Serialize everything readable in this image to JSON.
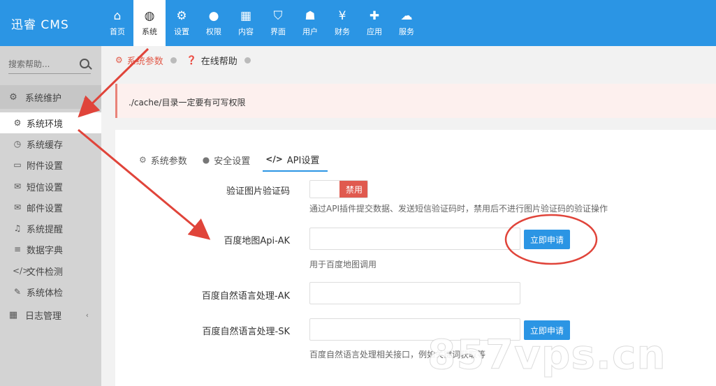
{
  "app": {
    "title": "迅睿 CMS"
  },
  "topnav": {
    "items": [
      {
        "label": "首页",
        "icon": "home-icon"
      },
      {
        "label": "系统",
        "icon": "globe-icon",
        "active": true
      },
      {
        "label": "设置",
        "icon": "gears-icon"
      },
      {
        "label": "权限",
        "icon": "user-circle-icon"
      },
      {
        "label": "内容",
        "icon": "grid-icon"
      },
      {
        "label": "界面",
        "icon": "html5-icon"
      },
      {
        "label": "用户",
        "icon": "user-icon"
      },
      {
        "label": "财务",
        "icon": "yen-icon"
      },
      {
        "label": "应用",
        "icon": "puzzle-icon"
      },
      {
        "label": "服务",
        "icon": "cloud-icon"
      }
    ]
  },
  "sidebar": {
    "search_placeholder": "搜索帮助...",
    "group": {
      "label": "系统维护",
      "icon": "gear-icon"
    },
    "items": [
      {
        "label": "系统环境",
        "icon": "gear-icon",
        "active": true
      },
      {
        "label": "系统缓存",
        "icon": "clock-icon"
      },
      {
        "label": "附件设置",
        "icon": "folder-icon"
      },
      {
        "label": "短信设置",
        "icon": "envelope-icon"
      },
      {
        "label": "邮件设置",
        "icon": "envelope-open-icon"
      },
      {
        "label": "系统提醒",
        "icon": "bell-icon"
      },
      {
        "label": "数据字典",
        "icon": "database-icon"
      },
      {
        "label": "文件检测",
        "icon": "code-icon"
      },
      {
        "label": "系统体检",
        "icon": "wrench-icon"
      }
    ],
    "group2": {
      "label": "日志管理",
      "icon": "calendar-icon"
    }
  },
  "breadcrumb": {
    "items": [
      {
        "label": "系统参数",
        "active": true
      },
      {
        "label": "在线帮助",
        "active": false
      }
    ]
  },
  "notice": {
    "text": "./cache/目录一定要有可写权限"
  },
  "tabs": [
    {
      "label": "系统参数",
      "icon": "gear-icon"
    },
    {
      "label": "安全设置",
      "icon": "lock-icon"
    },
    {
      "label": "API设置",
      "icon": "code-icon",
      "active": true
    }
  ],
  "form": {
    "captcha": {
      "label": "验证图片验证码",
      "toggle_label": "禁用",
      "help": "通过API插件提交数据、发送短信验证码时，禁用后不进行图片验证码的验证操作"
    },
    "baidu_map": {
      "label": "百度地图Api-AK",
      "value": "",
      "button": "立即申请",
      "help": "用于百度地图调用"
    },
    "nlp_ak": {
      "label": "百度自然语言处理-AK",
      "value": ""
    },
    "nlp_sk": {
      "label": "百度自然语言处理-SK",
      "value": "",
      "button": "立即申请",
      "help": "百度自然语言处理相关接口，例如关键词获取等"
    }
  },
  "watermark": "857vps.cn",
  "colors": {
    "primary": "#2b95e4",
    "danger": "#e05a4f",
    "sidebar": "#d3d3d3",
    "annotation": "#e0443a"
  }
}
